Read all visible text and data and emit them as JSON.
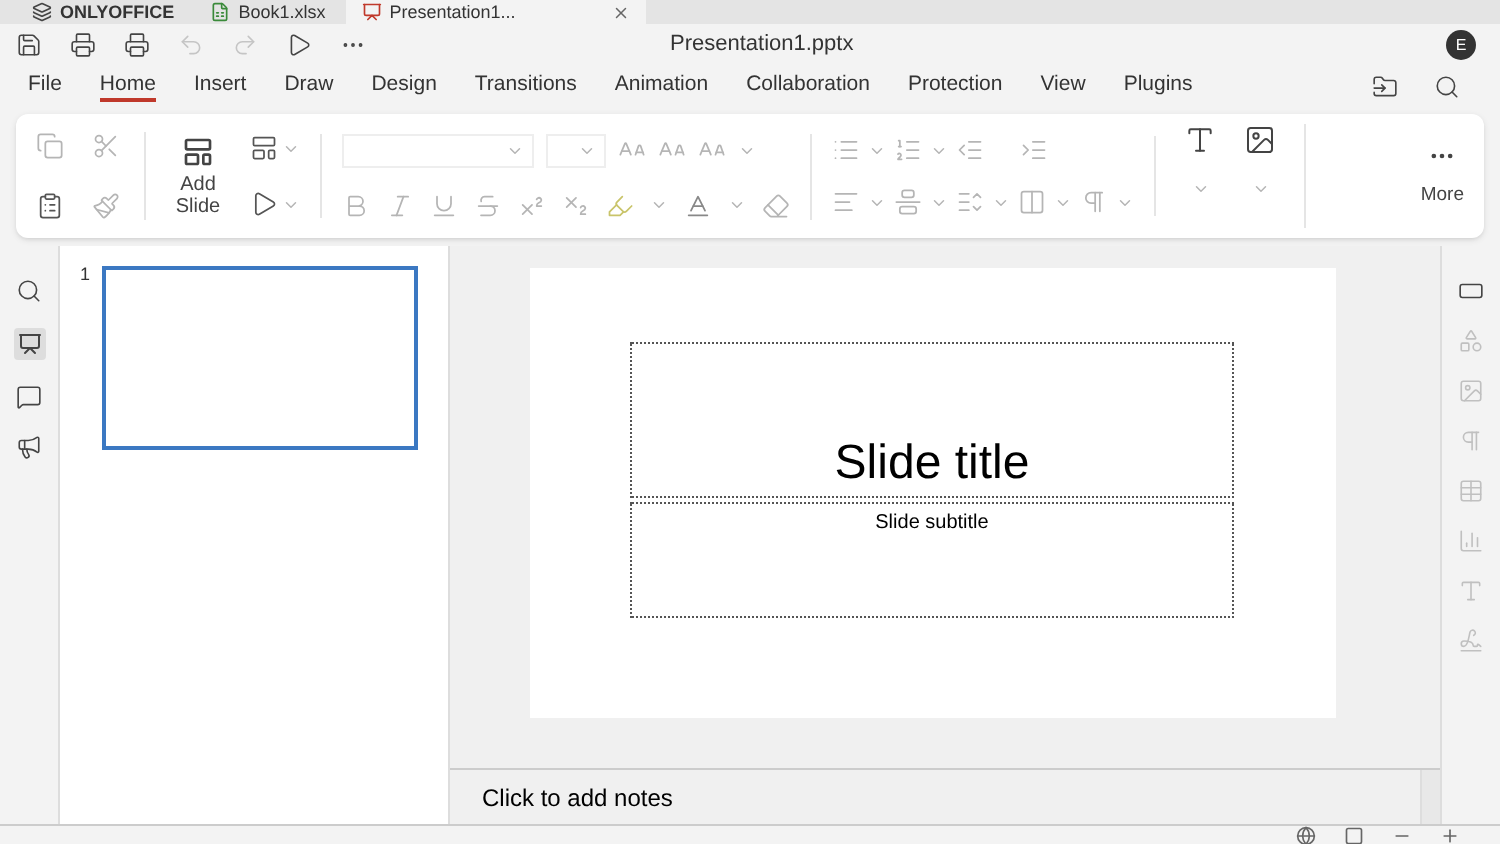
{
  "app_tabs": [
    {
      "label": "ONLYOFFICE",
      "kind": "logo",
      "selected": false
    },
    {
      "label": "Book1.xlsx",
      "kind": "sheet",
      "selected": false
    },
    {
      "label": "Presentation1...",
      "kind": "slides",
      "selected": true
    }
  ],
  "title": "Presentation1.pptx",
  "user_initial": "E",
  "menu": [
    {
      "label": "File",
      "selected": false
    },
    {
      "label": "Home",
      "selected": true
    },
    {
      "label": "Insert",
      "selected": false
    },
    {
      "label": "Draw",
      "selected": false
    },
    {
      "label": "Design",
      "selected": false
    },
    {
      "label": "Transitions",
      "selected": false
    },
    {
      "label": "Animation",
      "selected": false
    },
    {
      "label": "Collaboration",
      "selected": false
    },
    {
      "label": "Protection",
      "selected": false
    },
    {
      "label": "View",
      "selected": false
    },
    {
      "label": "Plugins",
      "selected": false
    }
  ],
  "ribbon": {
    "add_slide": "Add Slide",
    "more": "More"
  },
  "slides": [
    {
      "number": "1",
      "selected": true
    }
  ],
  "slide": {
    "title": "Slide title",
    "subtitle": "Slide subtitle"
  },
  "notes": {
    "placeholder": "Click to add notes"
  }
}
